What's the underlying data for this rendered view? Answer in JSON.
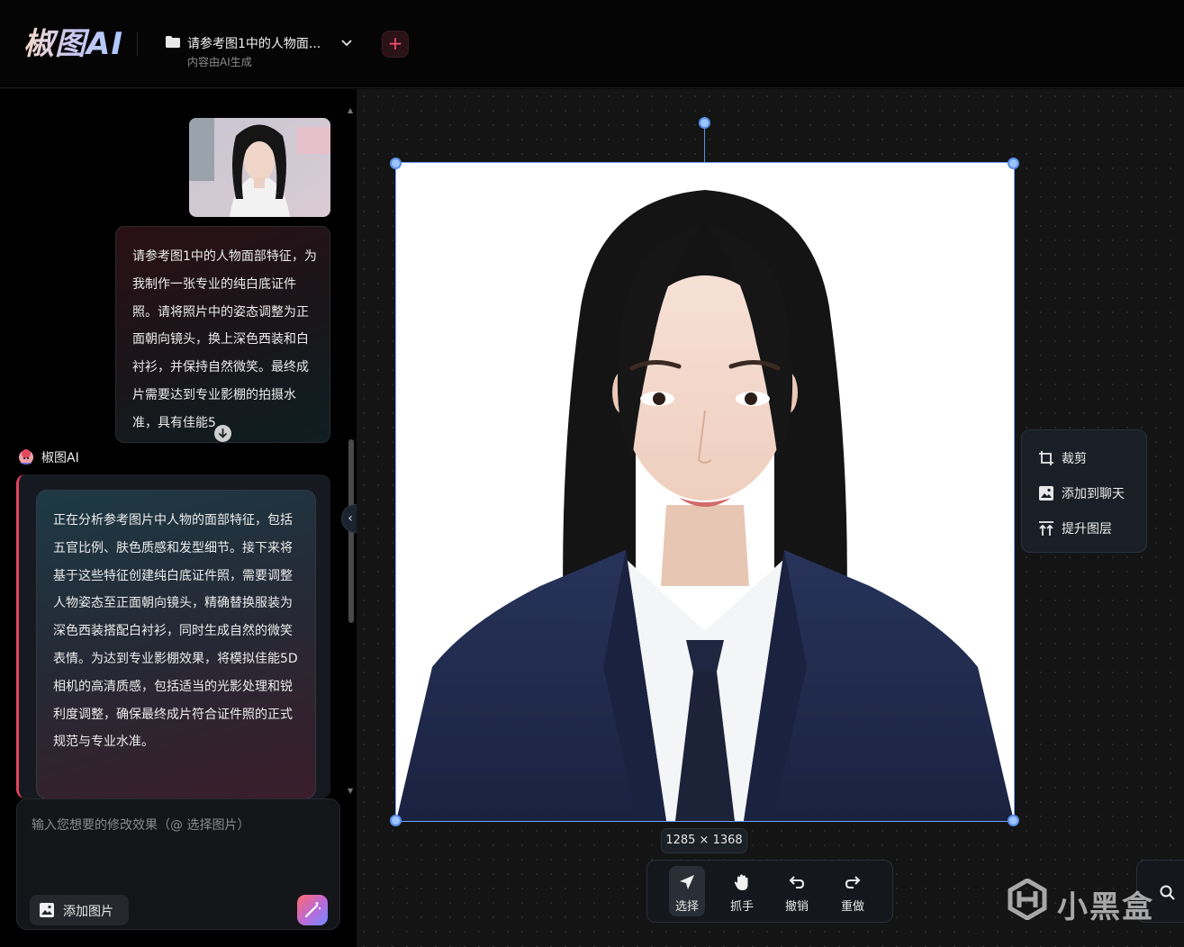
{
  "header": {
    "logo": "椒图AI",
    "project_title": "请参考图1中的人物面...",
    "project_subtitle": "内容由AI生成",
    "new_button": "+"
  },
  "chat": {
    "user_message": "请参考图1中的人物面部特征，为我制作一张专业的纯白底证件照。请将照片中的姿态调整为正面朝向镜头，换上深色西装和白衬衫，并保持自然微笑。最终成片需要达到专业影棚的拍摄水准，具有佳能5",
    "ai_name": "椒图AI",
    "ai_message": "正在分析参考图片中人物的面部特征，包括五官比例、肤色质感和发型细节。接下来将基于这些特征创建纯白底证件照，需要调整人物姿态至正面朝向镜头，精确替换服装为深色西装搭配白衬衫，同时生成自然的微笑表情。为达到专业影棚效果，将模拟佳能5D相机的高清质感，包括适当的光影处理和锐利度调整，确保最终成片符合证件照的正式规范与专业水准。",
    "collapse_icon": "‹"
  },
  "input": {
    "placeholder": "输入您想要的修改效果（@ 选择图片）",
    "add_image_label": "添加图片"
  },
  "canvas": {
    "image_size": "1285 × 1368",
    "context_menu": [
      {
        "icon": "crop-icon",
        "label": "裁剪"
      },
      {
        "icon": "image-icon",
        "label": "添加到聊天"
      },
      {
        "icon": "layer-up-icon",
        "label": "提升图层"
      }
    ],
    "tools": [
      {
        "icon": "cursor-icon",
        "label": "选择",
        "active": true
      },
      {
        "icon": "hand-icon",
        "label": "抓手",
        "active": false
      },
      {
        "icon": "undo-icon",
        "label": "撤销",
        "active": false
      },
      {
        "icon": "redo-icon",
        "label": "重做",
        "active": false
      }
    ]
  },
  "watermark": "小黑盒",
  "colors": {
    "accent_red": "#e0455f",
    "handle_blue": "#5a8fe8",
    "suit_navy": "#1e2743"
  }
}
